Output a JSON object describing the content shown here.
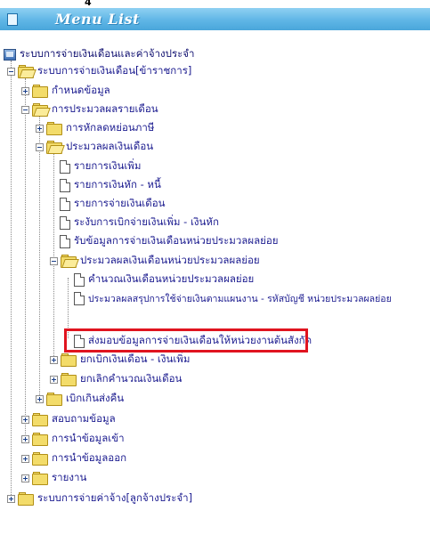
{
  "caption": "4",
  "menu": {
    "title": "Menu List"
  },
  "tree": {
    "root": "ระบบการจ่ายเงินเดือนและค่าจ้างประจำ",
    "items": [
      "ระบบการจ่ายเงินเดือน[ข้าราชการ]",
      "กำหนดข้อมูล",
      "การประมวลผลรายเดือน",
      "การหักลดหย่อนภาษี",
      "ประมวลผลเงินเดือน",
      "รายการเงินเพิ่ม",
      "รายการเงินหัก - หนี้",
      "รายการจ่ายเงินเดือน",
      "ระงับการเบิกจ่ายเงินเพิ่ม - เงินหัก",
      "รับข้อมูลการจ่ายเงินเดือนหน่วยประมวลผลย่อย",
      "ประมวลผลเงินเดือนหน่วยประมวลผลย่อย",
      "คำนวณเงินเดือนหน่วยประมวลผลย่อย",
      "ประมวลผลสรุปการใช้จ่ายเงินตามแผนงาน - รหัสบัญชี หน่วยประมวลผลย่อย",
      "ส่งมอบข้อมูลการจ่ายเงินเดือนให้หน่วยงานต้นสังกัด",
      "ยกเบิกเงินเดือน - เงินเพิ่ม",
      "ยกเลิกคำนวณเงินเดือน",
      "เบิกเกินส่งคืน",
      "สอบถามข้อมูล",
      "การนำข้อมูลเข้า",
      "การนำข้อมูลออก",
      "รายงาน",
      "ระบบการจ่ายค่าจ้าง[ลูกจ้างประจำ]"
    ]
  },
  "colors": {
    "header": "#5fb6e6",
    "highlight": "#e0141f",
    "link": "#1b1b8f"
  }
}
